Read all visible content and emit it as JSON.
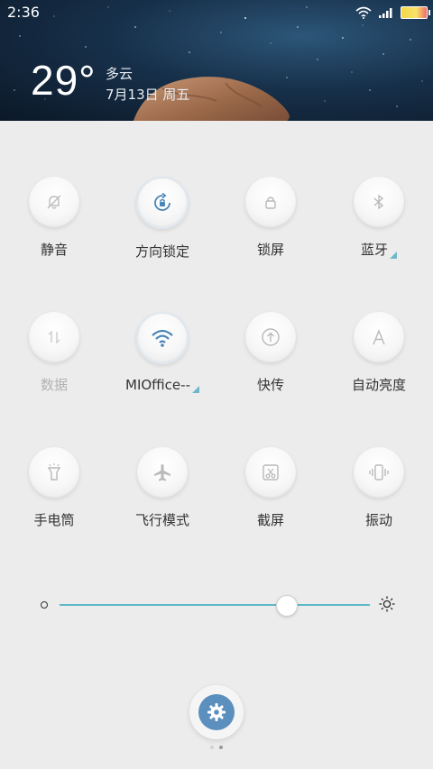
{
  "status_bar": {
    "time": "2:36",
    "icons": [
      "wifi-icon",
      "signal-icon",
      "battery-icon"
    ]
  },
  "weather": {
    "temperature": "29°",
    "condition": "多云",
    "date": "7月13日 周五"
  },
  "tiles": [
    {
      "label": "静音",
      "icon": "silent-bell-icon",
      "active": false,
      "disabled": false
    },
    {
      "label": "方向锁定",
      "icon": "rotation-lock-icon",
      "active": true,
      "disabled": false
    },
    {
      "label": "锁屏",
      "icon": "lock-icon",
      "active": false,
      "disabled": false
    },
    {
      "label": "蓝牙",
      "icon": "bluetooth-icon",
      "active": false,
      "disabled": false,
      "has_more": true
    },
    {
      "label": "数据",
      "icon": "mobile-data-icon",
      "active": false,
      "disabled": true
    },
    {
      "label": "MIOffice--",
      "icon": "wifi-icon",
      "active": true,
      "disabled": false,
      "has_more": true
    },
    {
      "label": "快传",
      "icon": "quick-transfer-icon",
      "active": false,
      "disabled": false
    },
    {
      "label": "自动亮度",
      "icon": "auto-brightness-icon",
      "active": false,
      "disabled": false
    },
    {
      "label": "手电筒",
      "icon": "flashlight-icon",
      "active": false,
      "disabled": false
    },
    {
      "label": "飞行模式",
      "icon": "airplane-icon",
      "active": false,
      "disabled": false
    },
    {
      "label": "截屏",
      "icon": "screenshot-icon",
      "active": false,
      "disabled": false
    },
    {
      "label": "振动",
      "icon": "vibrate-icon",
      "active": false,
      "disabled": false
    }
  ],
  "brightness": {
    "level_fraction": 0.73,
    "accent": "#5cb8c4"
  },
  "settings": {
    "icon": "gear-icon",
    "accent": "#5b8fbd"
  },
  "pagination": {
    "current": 2,
    "total": 2
  }
}
